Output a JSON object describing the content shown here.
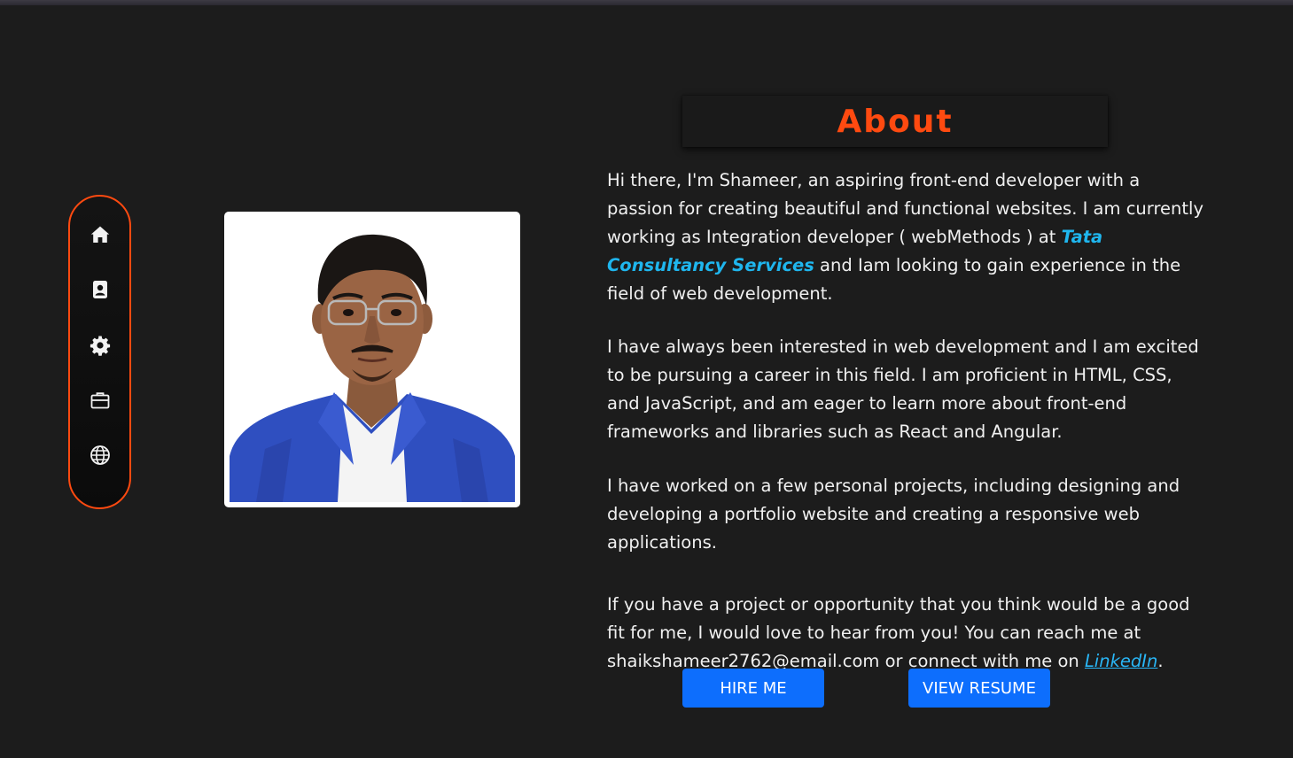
{
  "nav": {
    "items": [
      {
        "icon": "home-icon",
        "label": "Home"
      },
      {
        "icon": "contact-card-icon",
        "label": "About"
      },
      {
        "icon": "gear-icon",
        "label": "Skills"
      },
      {
        "icon": "briefcase-icon",
        "label": "Projects"
      },
      {
        "icon": "globe-icon",
        "label": "Contact"
      }
    ],
    "border_color": "#ff4a10"
  },
  "about": {
    "title": "About",
    "title_color": "#ff4a10",
    "p1_before": "Hi there, I'm Shameer, an aspiring front-end developer with a passion for creating beautiful and functional websites. I am currently working as Integration developer ( webMethods ) at ",
    "company": "Tata Consultancy Services",
    "p1_after": " and Iam looking to gain experience in the field of web development.",
    "p2": "I have always been interested in web development and I am excited to be pursuing a career in this field. I am proficient in HTML, CSS, and JavaScript, and am eager to learn more about front-end frameworks and libraries such as React and Angular.",
    "p3": "I have worked on a few personal projects, including designing and developing a portfolio website and creating a responsive web applications.",
    "p4_before": "If you have a project or opportunity that you think would be a good fit for me, I would love to hear from you! You can reach me at shaikshameer2762@email.com or connect with me on ",
    "linkedin": "LinkedIn",
    "p4_after": "."
  },
  "buttons": {
    "hire": "HIRE ME",
    "resume": "VIEW RESUME",
    "color": "#0d6efd"
  }
}
